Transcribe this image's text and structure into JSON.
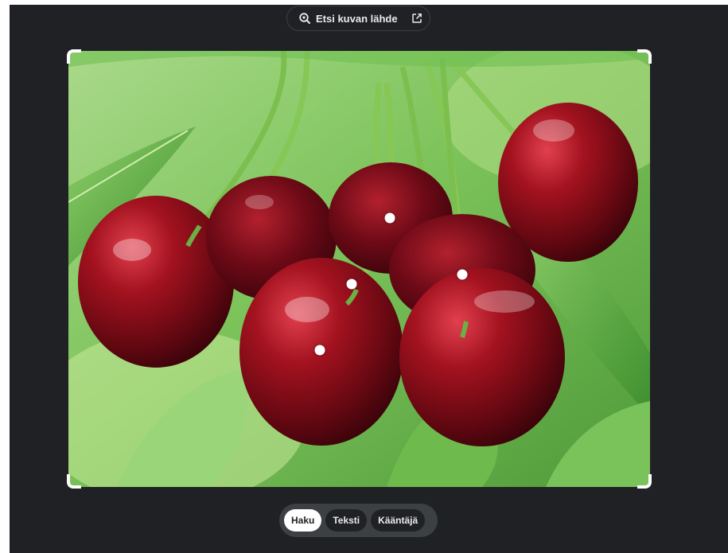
{
  "source_button": {
    "label": "Etsi kuvan lähde",
    "lens_icon": "lens-search-icon",
    "open_icon": "open-in-new-icon"
  },
  "image": {
    "subject": "cherries"
  },
  "modes": {
    "items": [
      {
        "label": "Haku",
        "active": true
      },
      {
        "label": "Teksti",
        "active": false
      },
      {
        "label": "Kääntäjä",
        "active": false
      }
    ]
  },
  "colors": {
    "background": "#202124",
    "active_tab": "#ffffff",
    "tab_bar": "#3c4043"
  }
}
